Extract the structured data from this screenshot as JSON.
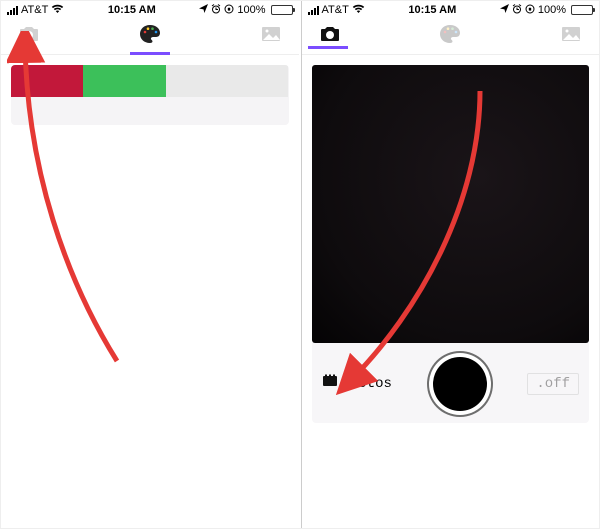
{
  "status": {
    "carrier": "AT&T",
    "wifi_icon": "wifi-icon",
    "time": "10:15 AM",
    "battery_pct": "100%",
    "arrow_icon": "location-icon",
    "alarm_icon": "alarm-icon",
    "orientation_icon": "orientation-lock-icon"
  },
  "left_phone": {
    "toolbar": {
      "camera": "camera-icon",
      "palette": "palette-icon",
      "picture": "picture-icon",
      "active_tab": "palette"
    },
    "palette_row": {
      "swatches": [
        {
          "color": "#c2183a",
          "width_pct": 26
        },
        {
          "color": "#3cc05a",
          "width_pct": 30
        },
        {
          "color": "#e9e9e9",
          "width_pct": 44
        }
      ],
      "progress_label": ""
    }
  },
  "right_phone": {
    "toolbar": {
      "camera": "camera-icon",
      "palette": "palette-icon",
      "picture": "picture-icon",
      "active_tab": "camera"
    },
    "controls": {
      "photos_label": "Photos",
      "off_label": ".off"
    }
  },
  "annotations": {
    "arrow_color": "#e53935"
  }
}
